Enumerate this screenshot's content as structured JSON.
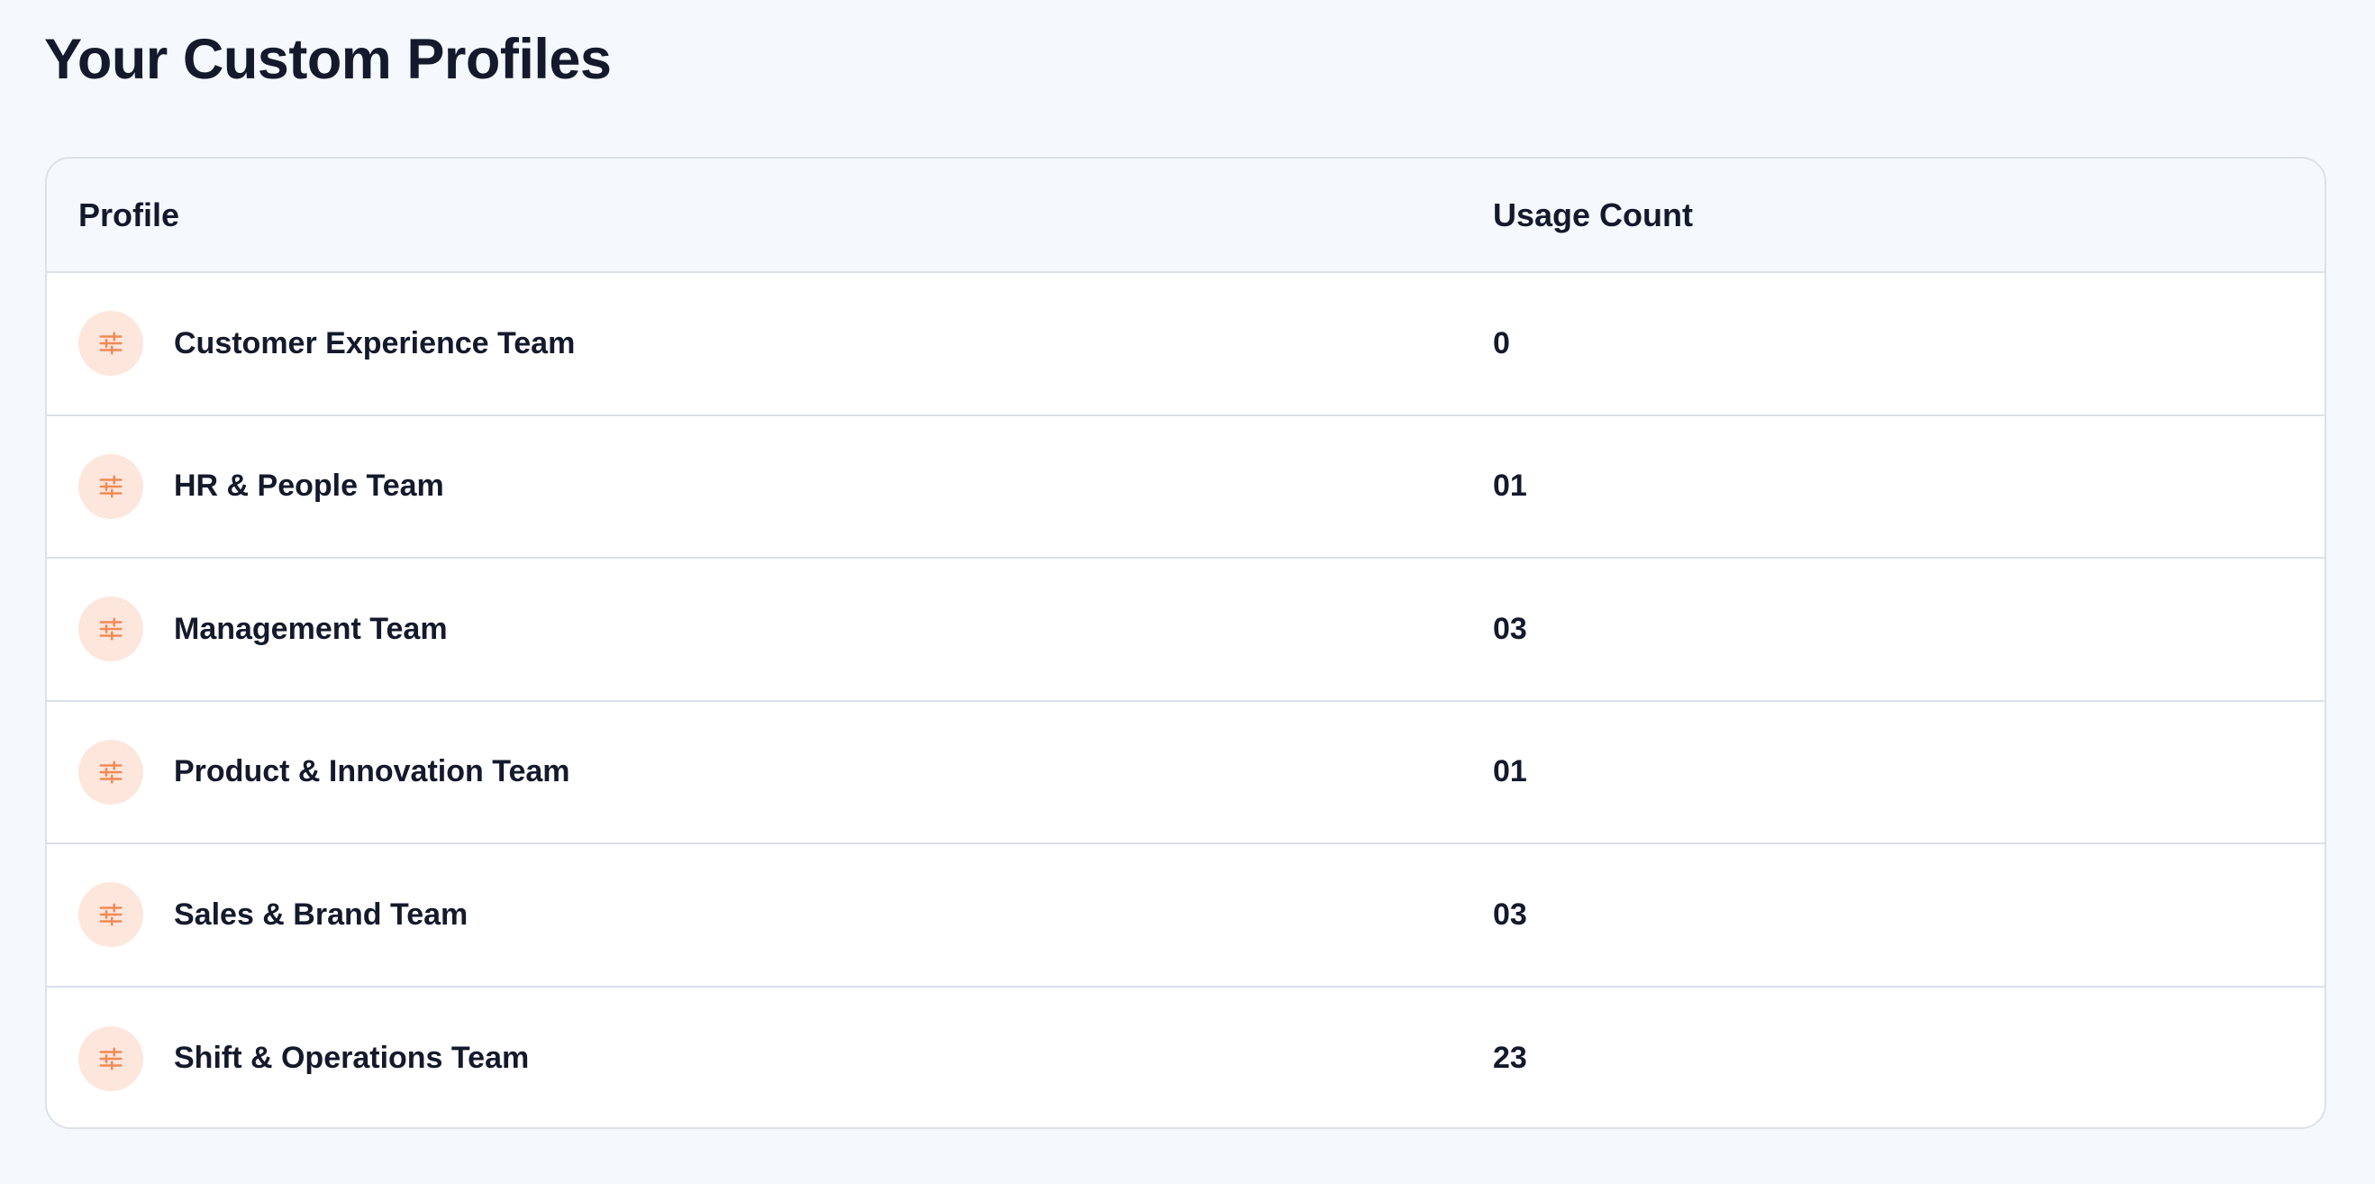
{
  "page": {
    "title": "Your Custom Profiles"
  },
  "table": {
    "columns": {
      "profile": "Profile",
      "usage_count": "Usage Count"
    },
    "rows": [
      {
        "name": "Customer Experience Team",
        "usage": "0",
        "icon": "sliders-icon"
      },
      {
        "name": "HR & People Team",
        "usage": "01",
        "icon": "sliders-icon"
      },
      {
        "name": "Management Team",
        "usage": "03",
        "icon": "sliders-icon"
      },
      {
        "name": "Product & Innovation Team",
        "usage": "01",
        "icon": "sliders-icon"
      },
      {
        "name": "Sales & Brand Team",
        "usage": "03",
        "icon": "sliders-icon"
      },
      {
        "name": "Shift & Operations Team",
        "usage": "23",
        "icon": "sliders-icon"
      }
    ]
  },
  "colors": {
    "background": "#f5f9fd",
    "text": "#141a2c",
    "border": "#dce1e8",
    "icon_badge_bg": "#fde6dc",
    "icon_accent": "#f08a57"
  }
}
